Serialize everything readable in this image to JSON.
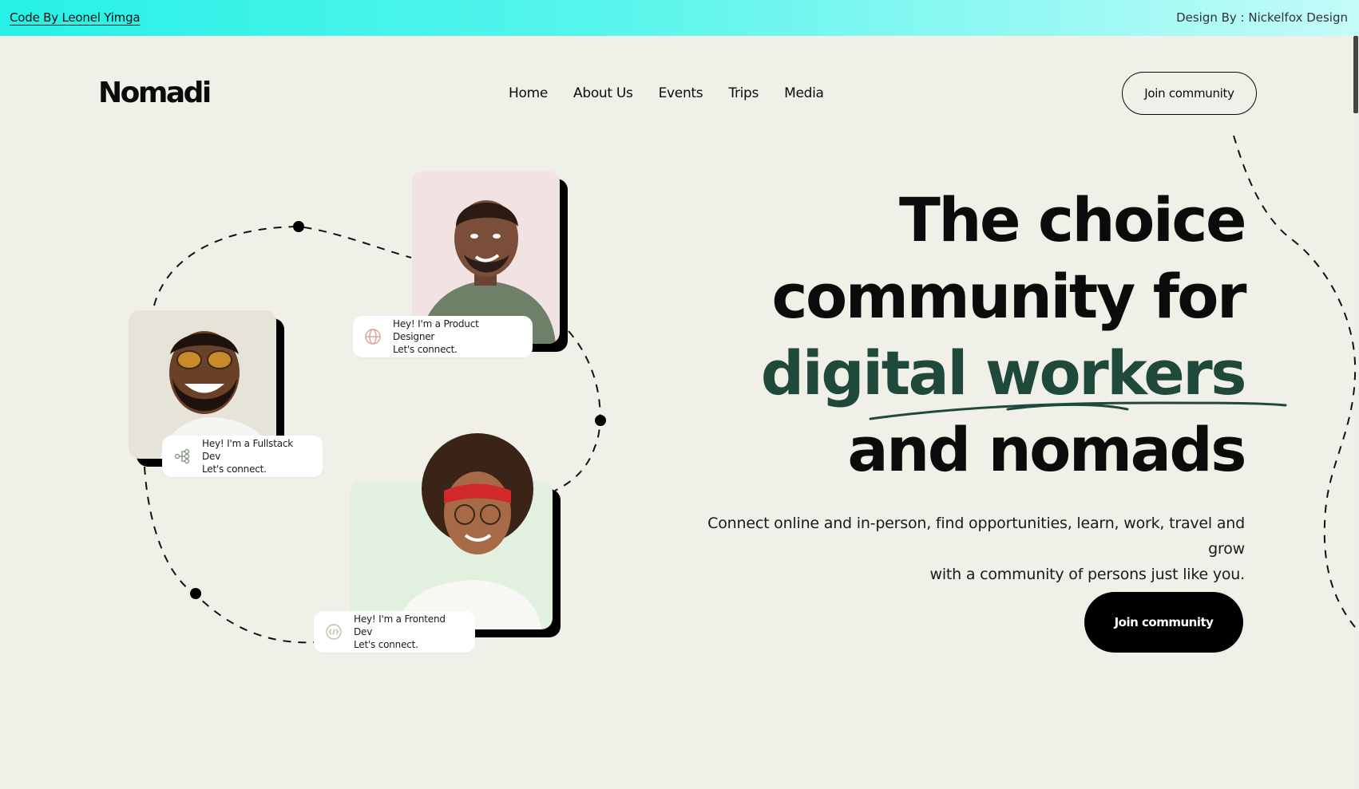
{
  "credits": {
    "code_by": "Code By Leonel Yimga",
    "design_by": "Design By : Nickelfox Design"
  },
  "header": {
    "logo": "Nomadi",
    "nav": [
      "Home",
      "About Us",
      "Events",
      "Trips",
      "Media"
    ],
    "cta": "Join community"
  },
  "hero": {
    "title_line1": "The choice",
    "title_line2": "community for",
    "title_line3": "digital workers",
    "title_line4": "and nomads",
    "subtitle_line1": "Connect online and in-person, find opportunities, learn, work, travel and grow",
    "subtitle_line2": "with a community of persons just like you.",
    "cta": "Join community",
    "accent_color": "#1f4a3b"
  },
  "profiles": [
    {
      "line1": "Hey! I'm a Product Designer",
      "line2": "Let's connect.",
      "icon": "globe-icon",
      "bg": "#f2e3e3"
    },
    {
      "line1": "Hey! I'm a Fullstack Dev",
      "line2": "Let's connect.",
      "icon": "network-icon",
      "bg": "#e6e4d8"
    },
    {
      "line1": "Hey! I'm a Frontend Dev",
      "line2": "Let's connect.",
      "icon": "code-icon",
      "bg": "#e2f0df"
    }
  ]
}
